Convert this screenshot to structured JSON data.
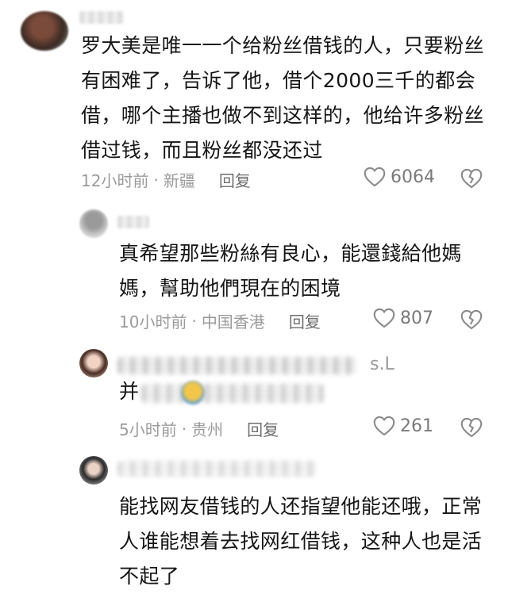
{
  "comments": [
    {
      "lines": [
        "罗大美是唯一一个给粉丝借钱的人，只要粉丝",
        "有困难了，告诉了他，借个2000三千的都会",
        "借，哪个主播也做不到这样的，他给许多粉丝",
        "借过钱，而且粉丝都没还过"
      ],
      "time": "12小时前",
      "location": "新疆",
      "reply_label": "回复",
      "likes": "6064"
    },
    {
      "lines": [
        "真希望那些粉絲有良心，能還錢給他媽",
        "媽，幫助他們現在的困境"
      ],
      "time": "10小时前",
      "location": "中国香港",
      "reply_label": "回复",
      "likes": "807"
    },
    {
      "name_fragment": "s.L",
      "body_fragment": "并",
      "time": "5小时前",
      "location": "贵州",
      "reply_label": "回复",
      "likes": "261"
    },
    {
      "lines": [
        "能找网友借钱的人还指望他能还哦，正常",
        "人谁能想着去找网红借钱，这种人也是活",
        "不起了"
      ]
    }
  ],
  "separator": "·",
  "colors": {
    "text": "#161616",
    "meta": "#9b9b9b",
    "reply": "#6d6d6d"
  },
  "icons": {
    "like": "heart-outline-icon",
    "dislike": "broken-heart-icon"
  }
}
